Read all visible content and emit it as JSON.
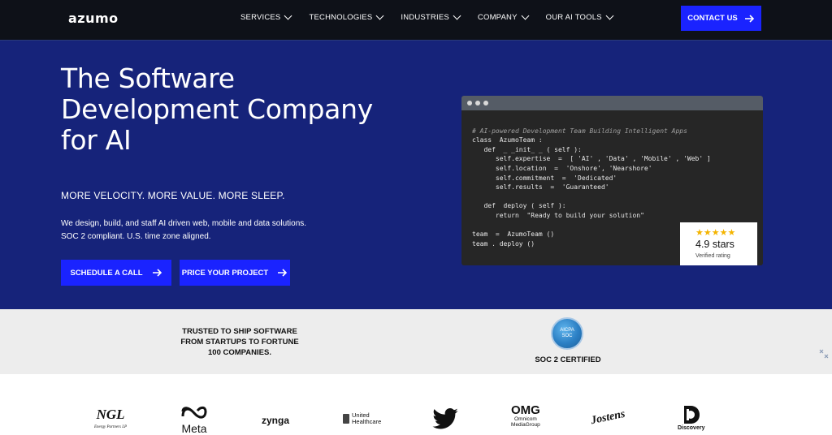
{
  "nav": {
    "logo": "azumo",
    "items": [
      {
        "label": "SERVICES"
      },
      {
        "label": "TECHNOLOGIES"
      },
      {
        "label": "INDUSTRIES"
      },
      {
        "label": "COMPANY"
      },
      {
        "label": "OUR AI TOOLS"
      }
    ],
    "contact_label": "CONTACT US"
  },
  "hero": {
    "title": "The Software Development Company for AI",
    "tagline": "MORE VELOCITY. MORE VALUE. MORE SLEEP.",
    "desc_line1": "We design, build, and staff AI driven web, mobile and data solutions.",
    "desc_line2": "SOC 2 compliant. U.S. time zone aligned.",
    "cta_schedule": "SCHEDULE A CALL",
    "cta_price": "PRICE YOUR PROJECT"
  },
  "code": {
    "lines": [
      "# AI-powered Development Team Building Intelligent Apps",
      "class  AzumoTeam :",
      "   def  _ _init_ _ ( self ):",
      "      self.expertise  =  [ 'AI' , 'Data' , 'Mobile' , 'Web' ]",
      "      self.location  =  'Onshore', 'Nearshore'",
      "      self.commitment  =  'Dedicated'",
      "      self.results  =  'Guaranteed'",
      "",
      "   def  deploy ( self ):",
      "      return  \"Ready to build your solution\"",
      "",
      "team  =  AzumoTeam ()",
      "team . deploy ()"
    ]
  },
  "rating": {
    "stars": "★★★★★",
    "value": "4.9 stars",
    "caption": "Verified rating"
  },
  "trust": {
    "text": "TRUSTED TO SHIP SOFTWARE FROM STARTUPS TO FORTUNE 100 COMPANIES.",
    "badge_top": "AICPA",
    "badge_mid": "SOC",
    "badge_caption": "SOC 2 CERTIFIED"
  },
  "logos": {
    "ngl": "NGL",
    "ngl_sub": "Energy Partners LP",
    "meta": "Meta",
    "zynga": "zynga",
    "uhc_line1": "United",
    "uhc_line2": "Healthcare",
    "omg": "OMG",
    "omg_sub1": "Omnicom",
    "omg_sub2": "MediaGroup",
    "jostens": "Jostens",
    "discovery": "Discovery"
  },
  "colors": {
    "nav_bg": "#0e1118",
    "hero_bg": "#16237a",
    "accent": "#1a23ff",
    "trust_bg": "#ededed"
  }
}
